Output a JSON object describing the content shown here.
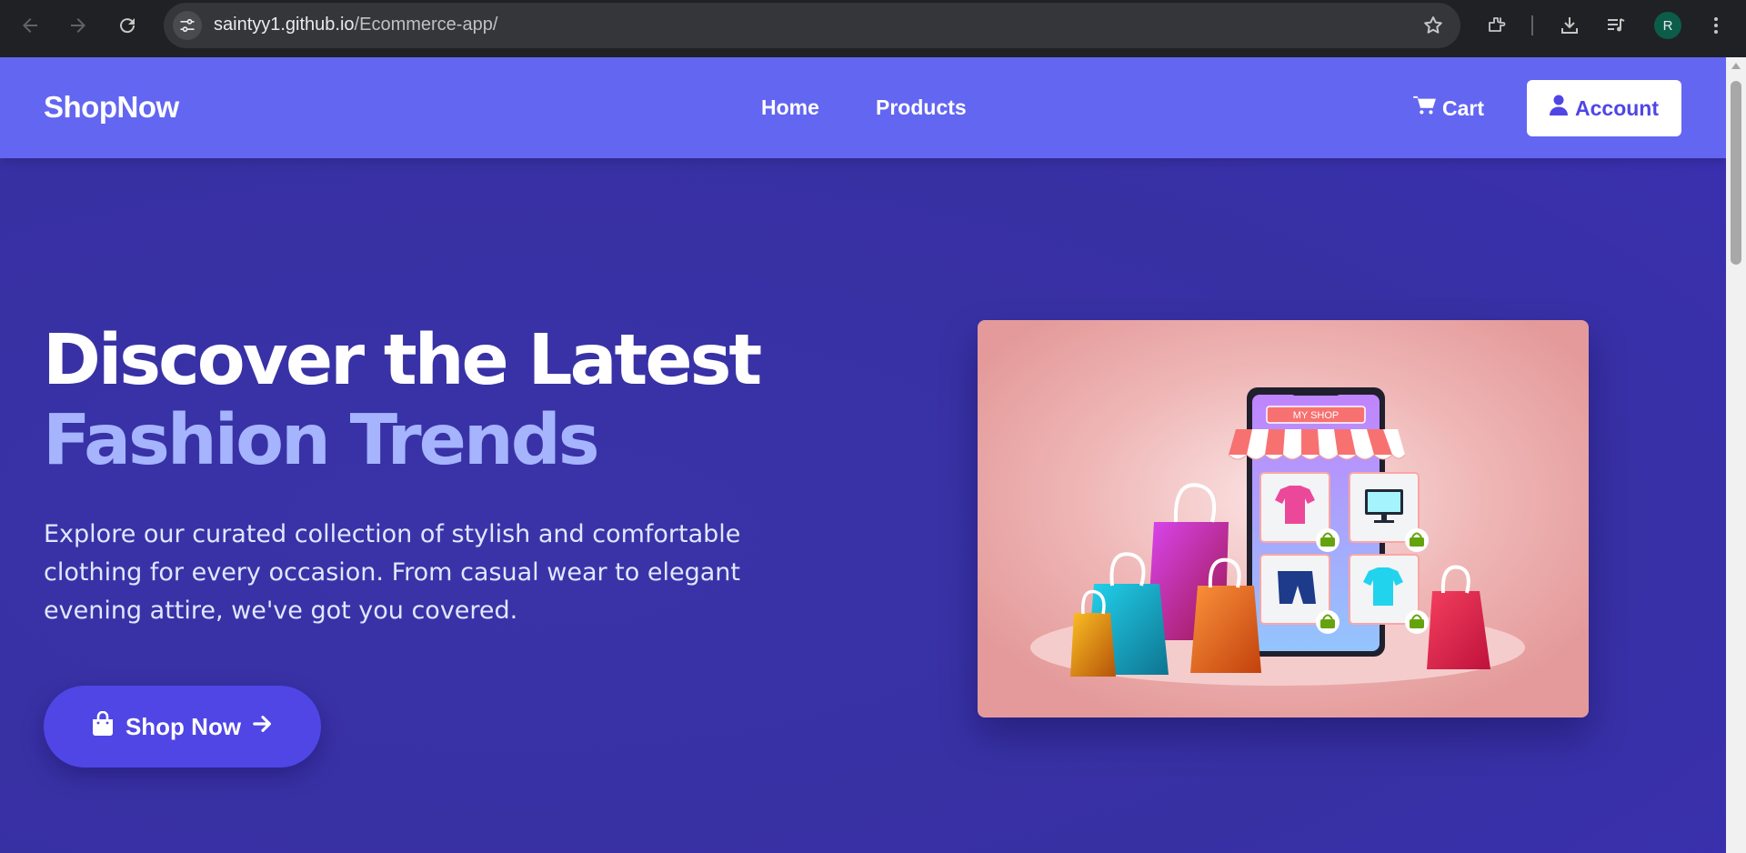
{
  "browser": {
    "url_host": "saintyy1.github.io",
    "url_path": "/Ecommerce-app/",
    "profile_initial": "R",
    "icons": [
      "back-icon",
      "forward-icon",
      "reload-icon",
      "site-settings-icon",
      "bookmark-star-icon",
      "extensions-icon",
      "download-icon",
      "media-control-icon",
      "menu-dots-icon"
    ]
  },
  "navbar": {
    "logo": "ShopNow",
    "links": [
      "Home",
      "Products"
    ],
    "cart_label": "Cart",
    "account_label": "Account",
    "colors": {
      "bar": "#6366f1",
      "account_text": "#4f46e5"
    }
  },
  "hero": {
    "title_line1": "Discover the Latest",
    "title_line2": "Fashion Trends",
    "description": "Explore our curated collection of stylish and comfortable clothing for every occasion. From casual wear to elegant evening attire, we've got you covered.",
    "cta_label": "Shop Now",
    "illustration_sign": "MY SHOP",
    "colors": {
      "background": "#3730a3",
      "accent_text": "#a5b4fc",
      "cta": "#4f46e5"
    }
  }
}
